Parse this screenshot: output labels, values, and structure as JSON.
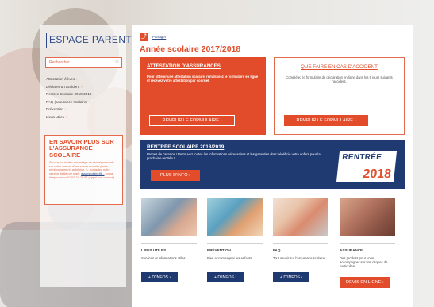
{
  "sidebar": {
    "title": "ESPACE PARENTS",
    "search_placeholder": "Rechercher",
    "nav": [
      {
        "label": "Attestation élèves"
      },
      {
        "label": "Déclarer un accident"
      },
      {
        "label": "Rentrée Scolaire 2018-2019"
      },
      {
        "label": "FAQ (assurance scolaire)"
      },
      {
        "label": "Prévention"
      },
      {
        "label": "Liens utiles"
      }
    ],
    "promo": {
      "title": "EN SAVOIR PLUS SUR L'ASSURANCE SCOLAIRE",
      "text": "Si vous souhaitez davantage de renseignements sur notre contrat d'assurance scolaire (tarifs, remboursement, adhésion...), contactez notre service dédié par mail :",
      "email": "assurscolaire@...",
      "text2": "ou par téléphone au 01 52 24 76 87 (appel non surtaxé)"
    }
  },
  "header": {
    "share_label": "Partager",
    "title": "Année scolaire 2017/2018"
  },
  "cards": {
    "attestation": {
      "title": "ATTESTATION D'ASSURANCES",
      "text": "Pour obtenir une attestation scolaire, remplissez le formulaire en ligne et recevez votre attestation par courriel.",
      "button": "REMPLIR LE FORMULAIRE"
    },
    "accident": {
      "title": "QUE FAIRE EN CAS D'ACCIDENT",
      "text": "Complétez le formulaire de déclaration en ligne dans les 5 jours suivants l'accident.",
      "button": "REMPLIR LE FORMULAIRE"
    }
  },
  "rentree": {
    "title": "RENTRÉE SCOLAIRE 2018/2019",
    "text": "Prenez de l'avance ! Retrouvez toutes les informations nécessaires et les garanties dont bénéficie votre enfant pour la prochaine rentrée !",
    "button": "PLUS D'INFO",
    "logo_word": "RENTRÉE",
    "logo_year": "2018"
  },
  "tiles": [
    {
      "heading": "LIENS UTILES",
      "text": "Services et informations utiles",
      "button": "+ D'INFOS"
    },
    {
      "heading": "PRÉVENTION",
      "text": "Bien accompagner les enfants",
      "button": "+ D'INFOS"
    },
    {
      "heading": "FAQ",
      "text": "Tout savoir sur l'assurance scolaire",
      "button": "+ D'INFOS"
    },
    {
      "heading": "ASSURANCE",
      "text": "Des produits pour vous accompagner sur vos risques de particuliers",
      "button": "DEVIS EN LIGNE"
    }
  ],
  "colors": {
    "accent": "#e34c2a",
    "navy": "#1f3a70"
  }
}
